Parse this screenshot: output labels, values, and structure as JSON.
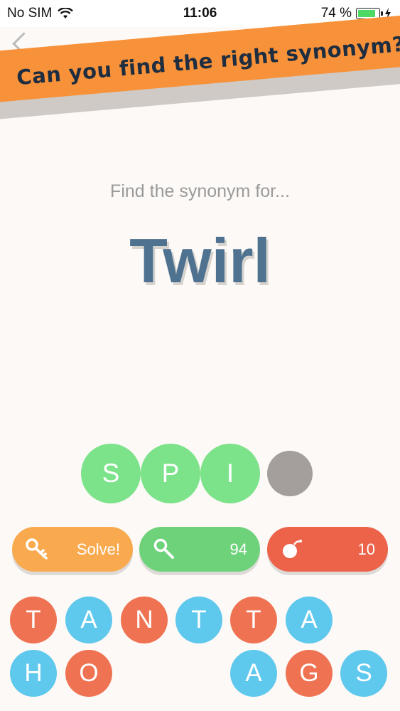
{
  "status": {
    "carrier": "No SIM",
    "time": "11:06",
    "battery": "74 %"
  },
  "banner": {
    "text": "Can you find the right synonym?"
  },
  "prompt": "Find the synonym for...",
  "word": "Twirl",
  "answer": [
    "S",
    "P",
    "I",
    ""
  ],
  "buttons": {
    "solve": "Solve!",
    "reveal": "94",
    "bomb": "10"
  },
  "tiles": [
    {
      "letter": "T",
      "color": "orange"
    },
    {
      "letter": "A",
      "color": "blue"
    },
    {
      "letter": "N",
      "color": "orange"
    },
    {
      "letter": "T",
      "color": "blue"
    },
    {
      "letter": "T",
      "color": "orange"
    },
    {
      "letter": "A",
      "color": "blue"
    },
    {
      "letter": "H",
      "color": "blue"
    },
    {
      "letter": "O",
      "color": "orange"
    },
    {
      "letter": "A",
      "color": "blue"
    },
    {
      "letter": "G",
      "color": "orange"
    },
    {
      "letter": "S",
      "color": "blue"
    }
  ],
  "colors": {
    "banner": "#f7923a",
    "word": "#4f7291",
    "answer": "#7de38b",
    "solve": "#f9aa4f",
    "reveal": "#6ed27b",
    "bomb": "#ec634a",
    "tile_orange": "#ef7352",
    "tile_blue": "#5ec8ed"
  }
}
